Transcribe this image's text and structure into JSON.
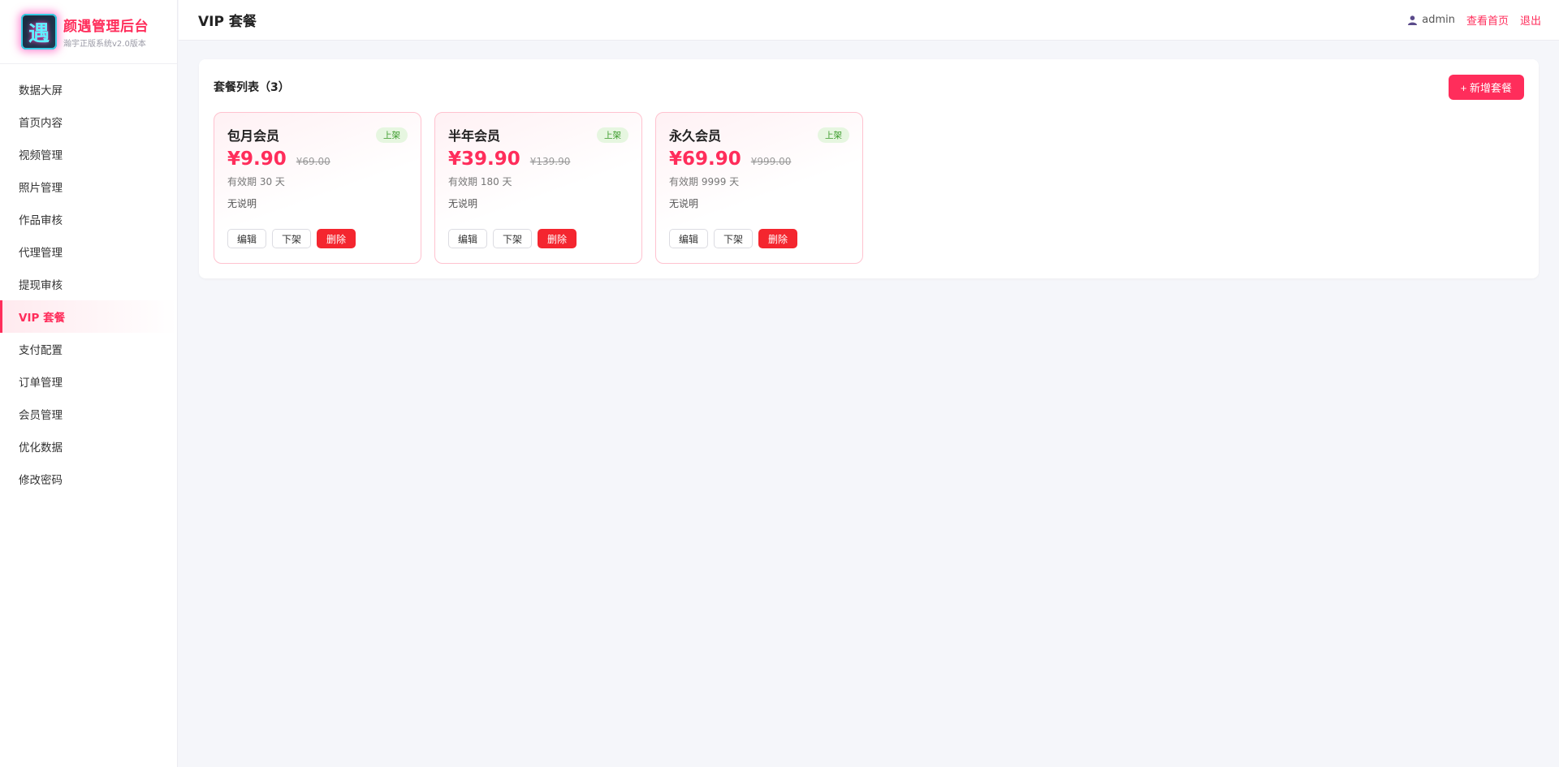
{
  "brand": {
    "title": "颜遇管理后台",
    "subtitle": "瀚宇正版系统v2.0版本",
    "logo_glyph": "遇"
  },
  "sidebar": {
    "items": [
      {
        "label": "数据大屏",
        "active": false
      },
      {
        "label": "首页内容",
        "active": false
      },
      {
        "label": "视频管理",
        "active": false
      },
      {
        "label": "照片管理",
        "active": false
      },
      {
        "label": "作品审核",
        "active": false
      },
      {
        "label": "代理管理",
        "active": false
      },
      {
        "label": "提现审核",
        "active": false
      },
      {
        "label": "VIP 套餐",
        "active": true
      },
      {
        "label": "支付配置",
        "active": false
      },
      {
        "label": "订单管理",
        "active": false
      },
      {
        "label": "会员管理",
        "active": false
      },
      {
        "label": "优化数据",
        "active": false
      },
      {
        "label": "修改密码",
        "active": false
      }
    ]
  },
  "topbar": {
    "title": "VIP 套餐",
    "user_icon": "user-icon",
    "username": "admin",
    "view_home": "查看首页",
    "logout": "退出"
  },
  "panel": {
    "title": "套餐列表（3）",
    "add_button": "+ 新增套餐"
  },
  "plans": [
    {
      "name": "包月会员",
      "status": "上架",
      "price": "¥9.90",
      "original": "¥69.00",
      "validity": "有效期 30 天",
      "desc": "无说明",
      "edit": "编辑",
      "offshelf": "下架",
      "delete": "删除"
    },
    {
      "name": "半年会员",
      "status": "上架",
      "price": "¥39.90",
      "original": "¥139.90",
      "validity": "有效期 180 天",
      "desc": "无说明",
      "edit": "编辑",
      "offshelf": "下架",
      "delete": "删除"
    },
    {
      "name": "永久会员",
      "status": "上架",
      "price": "¥69.90",
      "original": "¥999.00",
      "validity": "有效期 9999 天",
      "desc": "无说明",
      "edit": "编辑",
      "offshelf": "下架",
      "delete": "删除"
    }
  ],
  "colors": {
    "accent": "#ff2d5b",
    "danger": "#f4262f",
    "badge_text": "#3a9a2a",
    "badge_bg": "#e6f6e0"
  }
}
